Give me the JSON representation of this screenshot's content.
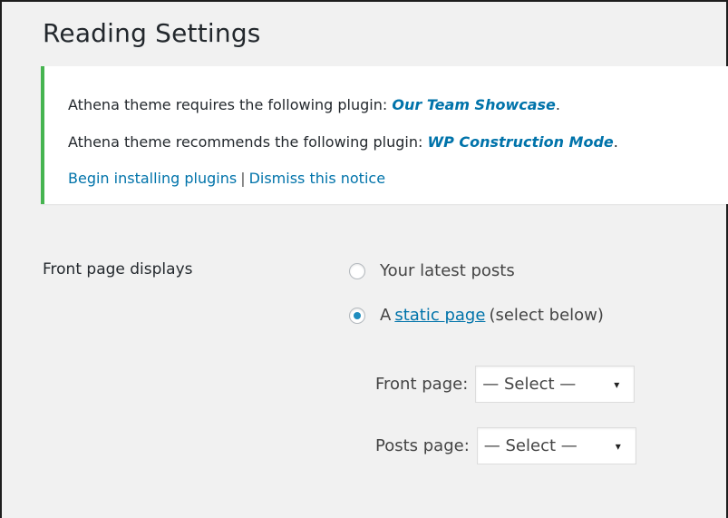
{
  "page": {
    "title": "Reading Settings"
  },
  "notice": {
    "requires_text": "Athena theme requires the following plugin: ",
    "requires_plugin": "Our Team Showcase",
    "requires_end": ".",
    "recommends_text": "Athena theme recommends the following plugin: ",
    "recommends_plugin": "WP Construction Mode",
    "recommends_end": ".",
    "begin_link": "Begin installing plugins",
    "separator": "|",
    "dismiss_link": "Dismiss this notice",
    "border_color": "#46b450",
    "link_color": "#0073aa"
  },
  "front_page_displays": {
    "label": "Front page displays",
    "options": [
      {
        "label": "Your latest posts",
        "checked": false
      },
      {
        "label_prefix": "A",
        "link": "static page",
        "label_suffix": "(select below)",
        "checked": true
      }
    ],
    "front_page": {
      "label": "Front page:",
      "value": "— Select —"
    },
    "posts_page": {
      "label": "Posts page:",
      "value": "— Select —"
    }
  },
  "icons": {
    "select_caret": "▾"
  }
}
